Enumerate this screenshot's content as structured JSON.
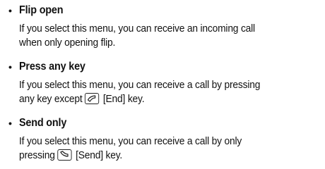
{
  "items": [
    {
      "bullet": "•",
      "title": "Flip open",
      "line1": "If you select this menu, you can receive an incoming call",
      "line2": "when only opening flip."
    },
    {
      "bullet": "•",
      "title": "Press any key",
      "line1": "If you select this menu, you can receive a call by pressing",
      "line2_pre": "any key except ",
      "line2_post": " [End] key.",
      "icon": "end-key-icon"
    },
    {
      "bullet": "•",
      "title": "Send only",
      "line1": "If you select this menu, you can receive a call by only",
      "line2_pre": "pressing ",
      "line2_post": " [Send] key.",
      "icon": "send-key-icon"
    }
  ]
}
